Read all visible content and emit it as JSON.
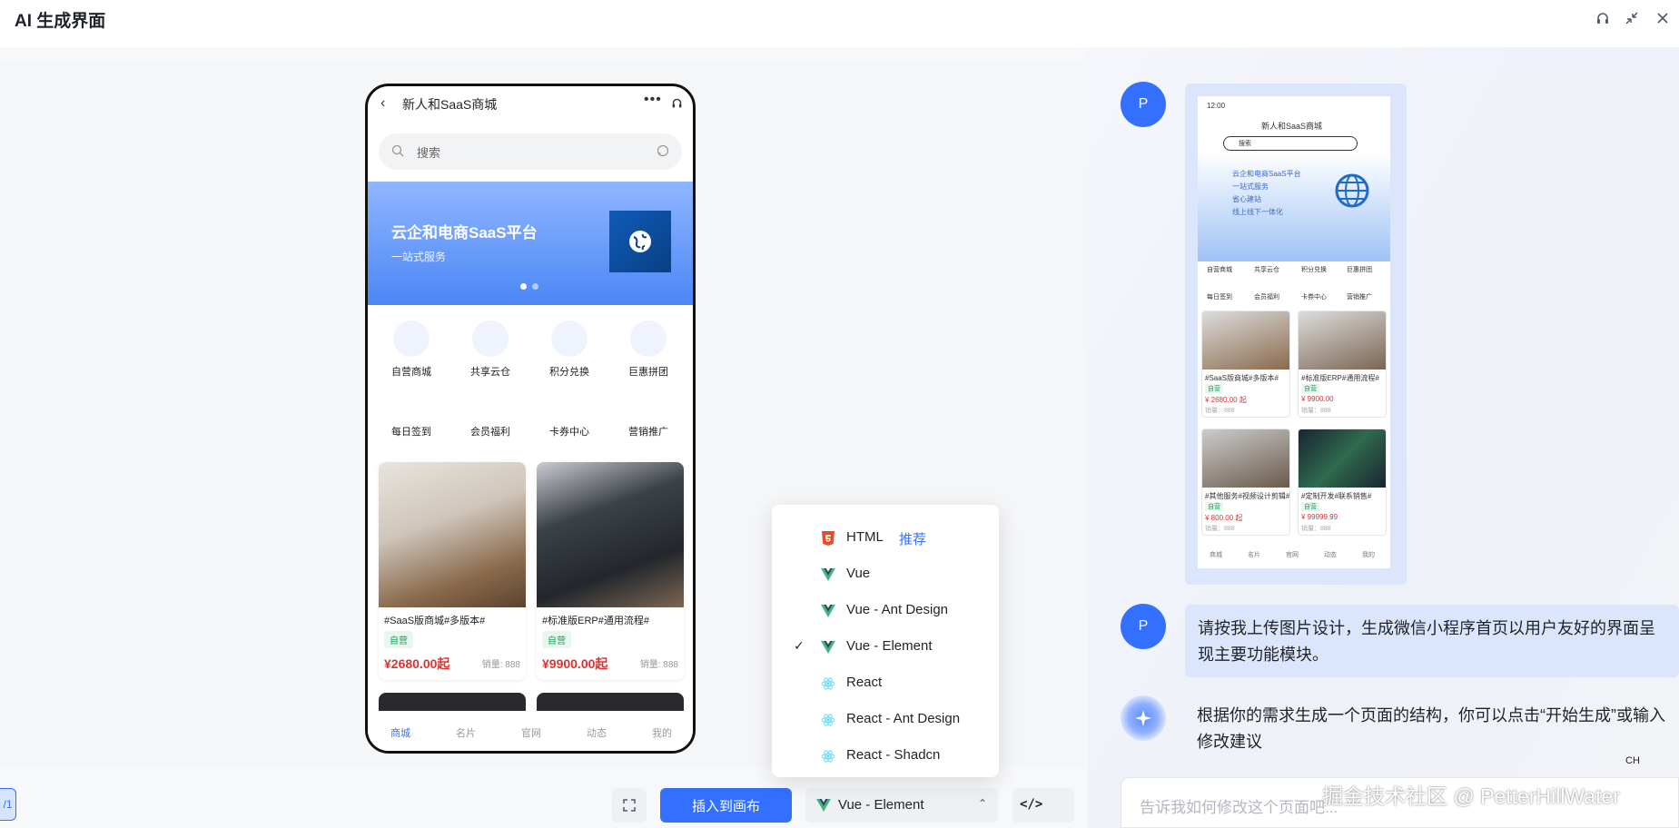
{
  "app": {
    "title": "AI 生成界面"
  },
  "window": {
    "icons": [
      "headset-icon",
      "collapse-icon",
      "close-icon"
    ]
  },
  "phone": {
    "title": "新人和SaaS商城",
    "search_placeholder": "搜索",
    "banner": {
      "title": "云企和电商SaaS平台",
      "subtitle": "一站式服务"
    },
    "icons_row1": [
      "自营商城",
      "共享云仓",
      "积分兑换",
      "巨惠拼团"
    ],
    "icons_row2": [
      "每日签到",
      "会员福利",
      "卡券中心",
      "营销推广"
    ],
    "products": [
      {
        "title": "#SaaS版商城#多版本#",
        "tag": "自营",
        "price": "¥2680.00起",
        "sold": "销量: 888"
      },
      {
        "title": "#标准版ERP#通用流程#",
        "tag": "自营",
        "price": "¥9900.00起",
        "sold": "销量: 888"
      }
    ],
    "tabs": [
      "商城",
      "名片",
      "官网",
      "动态",
      "我的"
    ],
    "active_tab": "商城"
  },
  "toolbar": {
    "pager": "/1",
    "insert_label": "插入到画布",
    "framework_selected": "Vue - Element",
    "code_icon": "</>"
  },
  "framework_menu": {
    "items": [
      {
        "label": "HTML",
        "badge": "推荐",
        "icon": "html5-icon"
      },
      {
        "label": "Vue",
        "icon": "vue-icon"
      },
      {
        "label": "Vue - Ant Design",
        "icon": "vue-icon"
      },
      {
        "label": "Vue - Element",
        "icon": "vue-icon",
        "checked": true
      },
      {
        "label": "React",
        "icon": "react-icon"
      },
      {
        "label": "React - Ant Design",
        "icon": "react-icon"
      },
      {
        "label": "React - Shadcn",
        "icon": "react-icon"
      }
    ]
  },
  "chat": {
    "user_initial": "P",
    "mockup": {
      "time": "12:00",
      "title": "新人和SaaS商城",
      "search": "搜索",
      "banner_lines": [
        "云企和电商SaaS平台",
        "一站式服务",
        "省心建站",
        "线上线下一体化"
      ],
      "icons_row1": [
        "自营商城",
        "共享云仓",
        "积分兑换",
        "巨惠拼团"
      ],
      "icons_row2": [
        "每日签到",
        "会员福利",
        "卡券中心",
        "营销推广"
      ],
      "cards": [
        {
          "title": "#SaaS版商城#多版本#",
          "tag": "自营",
          "price": "¥ 2680.00 起",
          "sold": "销量：888"
        },
        {
          "title": "#标准版ERP#通用流程#",
          "tag": "自营",
          "price": "¥ 9900.00",
          "sold": "销量：888"
        },
        {
          "title": "#其他服务#视频设计剪辑#",
          "tag": "自营",
          "price": "¥ 800.00 起",
          "sold": "销量：888"
        },
        {
          "title": "#定制开发#联系销售#",
          "tag": "自营",
          "price": "¥ 99999.99",
          "sold": "销量：888"
        }
      ],
      "tabs": [
        "商城",
        "名片",
        "官网",
        "动态",
        "我的"
      ]
    },
    "user_message": "请按我上传图片设计，生成微信小程序首页以用户友好的界面呈现主要功能模块。",
    "ai_message": "根据你的需求生成一个页面的结构，你可以点击“开始生成”或输入修改建议",
    "input_placeholder": "告诉我如何修改这个页面吧...",
    "ime": "CH"
  },
  "watermark": "掘金技术社区 @ PetterHillWater",
  "colors": {
    "primary": "#3370ff",
    "price": "#e03131",
    "tag_green": "#18a058"
  }
}
